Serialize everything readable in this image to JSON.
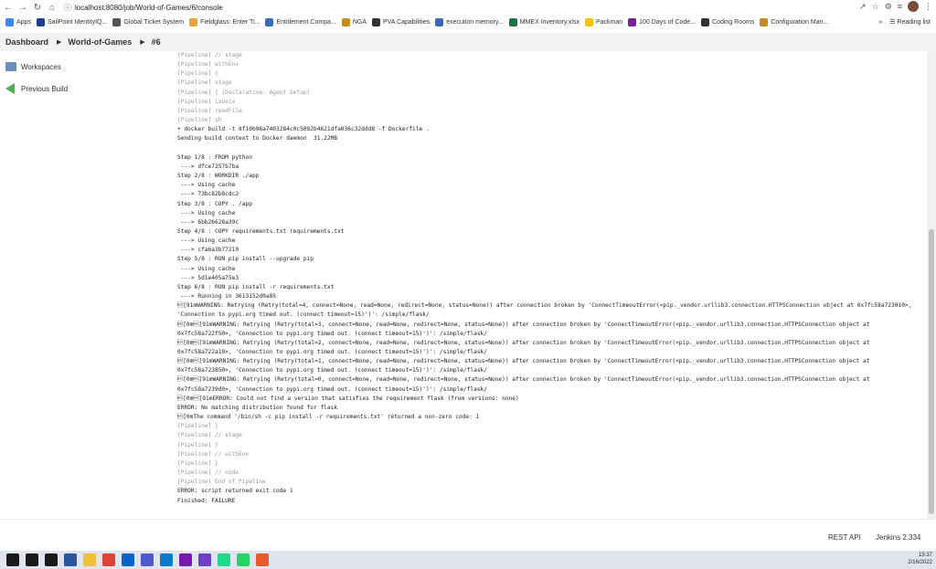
{
  "browser": {
    "url": "localhost:8080/job/World-of-Games/6/console",
    "bookmarks": [
      {
        "label": "Apps",
        "color": "#4285f4"
      },
      {
        "label": "SailPoint IdentityIQ...",
        "color": "#1c3f94"
      },
      {
        "label": "Global Ticket System",
        "color": "#555555"
      },
      {
        "label": "Fieldglass: Enter Ti...",
        "color": "#e8a33d"
      },
      {
        "label": "Entitlement Compa...",
        "color": "#3b6bb5"
      },
      {
        "label": "NGA",
        "color": "#c58b20"
      },
      {
        "label": "PVA Capabilities",
        "color": "#333333"
      },
      {
        "label": "execution memory...",
        "color": "#3b6bb5"
      },
      {
        "label": "MMEX Inventory.xlsx",
        "color": "#1e7145"
      },
      {
        "label": "Packman",
        "color": "#f4c20d"
      },
      {
        "label": "100 Days of Code...",
        "color": "#7b1fa2"
      },
      {
        "label": "Coding Rooms",
        "color": "#333333"
      },
      {
        "label": "Configuration Man...",
        "color": "#c58b20"
      }
    ],
    "reading_list": "Reading list",
    "more": "»"
  },
  "breadcrumb": {
    "dashboard": "Dashboard",
    "job": "World-of-Games",
    "build": "#6"
  },
  "sidebar": {
    "workspaces": "Workspaces",
    "previous_build": "Previous Build"
  },
  "console_lines": [
    {
      "text": "[Pipeline] // stage",
      "grey": true
    },
    {
      "text": "[Pipeline] withEnv",
      "grey": true
    },
    {
      "text": "[Pipeline] {",
      "grey": true
    },
    {
      "text": "[Pipeline] stage",
      "grey": true
    },
    {
      "text": "[Pipeline] { (Declarative: Agent Setup)",
      "grey": true
    },
    {
      "text": "[Pipeline] isUnix",
      "grey": true
    },
    {
      "text": "[Pipeline] readFile",
      "grey": true
    },
    {
      "text": "[Pipeline] sh",
      "grey": true
    },
    {
      "text": "+ docker build -t 8f10b98a7403284c0c5092b4621dfa036c32ddd8 -f Dockerfile .",
      "grey": false
    },
    {
      "text": "Sending build context to Docker daemon  31.22MB",
      "grey": false
    },
    {
      "text": "",
      "grey": false
    },
    {
      "text": "Step 1/8 : FROM python",
      "grey": false
    },
    {
      "text": " ---> dfce7257b7ba",
      "grey": false
    },
    {
      "text": "Step 2/8 : WORKDIR ./app",
      "grey": false
    },
    {
      "text": " ---> Using cache",
      "grey": false
    },
    {
      "text": " ---> 73bc82b8cdc2",
      "grey": false
    },
    {
      "text": "Step 3/8 : COPY . /app",
      "grey": false
    },
    {
      "text": " ---> Using cache",
      "grey": false
    },
    {
      "text": " ---> 6bb26628a39c",
      "grey": false
    },
    {
      "text": "Step 4/8 : COPY requirements.txt requirements.txt",
      "grey": false
    },
    {
      "text": " ---> Using cache",
      "grey": false
    },
    {
      "text": " ---> cfa6a3b77219",
      "grey": false
    },
    {
      "text": "Step 5/8 : RUN pip install --upgrade pip",
      "grey": false
    },
    {
      "text": " ---> Using cache",
      "grey": false
    },
    {
      "text": " ---> 5d1e405a75e3",
      "grey": false
    },
    {
      "text": "Step 6/8 : RUN pip install -r requirements.txt",
      "grey": false
    },
    {
      "text": " ---> Running in 3613152d0a85",
      "grey": false
    },
    {
      "text": "\u001b[91mWARNING: Retrying (Retry(total=4, connect=None, read=None, redirect=None, status=None)) after connection broken by 'ConnectTimeoutError(<pip._vendor.urllib3.connection.HTTPSConnection object at 0x7fc58a723010>,",
      "grey": false
    },
    {
      "text": "'Connection to pypi.org timed out. (connect timeout=15)')': /simple/flask/",
      "grey": false
    },
    {
      "text": "\u001b[0m\u001b[91mWARNING: Retrying (Retry(total=3, connect=None, read=None, redirect=None, status=None)) after connection broken by 'ConnectTimeoutError(<pip._vendor.urllib3.connection.HTTPSConnection object at",
      "grey": false
    },
    {
      "text": "0x7fc58a722f50>, 'Connection to pypi.org timed out. (connect timeout=15)')': /simple/flask/",
      "grey": false
    },
    {
      "text": "\u001b[0m\u001b[91mWARNING: Retrying (Retry(total=2, connect=None, read=None, redirect=None, status=None)) after connection broken by 'ConnectTimeoutError(<pip._vendor.urllib3.connection.HTTPSConnection object at",
      "grey": false
    },
    {
      "text": "0x7fc58a722a10>, 'Connection to pypi.org timed out. (connect timeout=15)')': /simple/flask/",
      "grey": false
    },
    {
      "text": "\u001b[0m\u001b[91mWARNING: Retrying (Retry(total=1, connect=None, read=None, redirect=None, status=None)) after connection broken by 'ConnectTimeoutError(<pip._vendor.urllib3.connection.HTTPSConnection object at",
      "grey": false
    },
    {
      "text": "0x7fc58a723850>, 'Connection to pypi.org timed out. (connect timeout=15)')': /simple/flask/",
      "grey": false
    },
    {
      "text": "\u001b[0m\u001b[91mWARNING: Retrying (Retry(total=0, connect=None, read=None, redirect=None, status=None)) after connection broken by 'ConnectTimeoutError(<pip._vendor.urllib3.connection.HTTPSConnection object at",
      "grey": false
    },
    {
      "text": "0x7fc58a7239d0>, 'Connection to pypi.org timed out. (connect timeout=15)')': /simple/flask/",
      "grey": false
    },
    {
      "text": "\u001b[0m\u001b[91mERROR: Could not find a version that satisfies the requirement flask (from versions: none)",
      "grey": false
    },
    {
      "text": "ERROR: No matching distribution found for flask",
      "grey": false
    },
    {
      "text": "\u001b[0mThe command '/bin/sh -c pip install -r requirements.txt' returned a non-zero code: 1",
      "grey": false
    },
    {
      "text": "[Pipeline] }",
      "grey": true
    },
    {
      "text": "[Pipeline] // stage",
      "grey": true
    },
    {
      "text": "[Pipeline] }",
      "grey": true
    },
    {
      "text": "[Pipeline] // withEnv",
      "grey": true
    },
    {
      "text": "[Pipeline] }",
      "grey": true
    },
    {
      "text": "[Pipeline] // node",
      "grey": true
    },
    {
      "text": "[Pipeline] End of Pipeline",
      "grey": true
    },
    {
      "text": "ERROR: script returned exit code 1",
      "grey": false
    },
    {
      "text": "Finished: FAILURE",
      "grey": false
    }
  ],
  "footer": {
    "rest_api": "REST API",
    "version": "Jenkins 2.334"
  },
  "taskbar": {
    "time": "15:37",
    "date": "2/16/2022",
    "icons": [
      {
        "name": "windows-start-icon",
        "color": "#1a1a1a"
      },
      {
        "name": "search-icon",
        "color": "#1a1a1a"
      },
      {
        "name": "task-view-icon",
        "color": "#1a1a1a"
      },
      {
        "name": "app-icon",
        "color": "#2b579a"
      },
      {
        "name": "file-explorer-icon",
        "color": "#f2c037"
      },
      {
        "name": "chrome-icon",
        "color": "#db4437"
      },
      {
        "name": "outlook-icon",
        "color": "#0a64c8"
      },
      {
        "name": "teams-icon",
        "color": "#5059c9"
      },
      {
        "name": "vscode-icon",
        "color": "#0a7acc"
      },
      {
        "name": "onenote-icon",
        "color": "#7719aa"
      },
      {
        "name": "github-icon",
        "color": "#6e40c9"
      },
      {
        "name": "pycharm-icon",
        "color": "#21d789"
      },
      {
        "name": "whatsapp-icon",
        "color": "#25d366"
      },
      {
        "name": "app-orange-icon",
        "color": "#e65a2b"
      }
    ]
  }
}
